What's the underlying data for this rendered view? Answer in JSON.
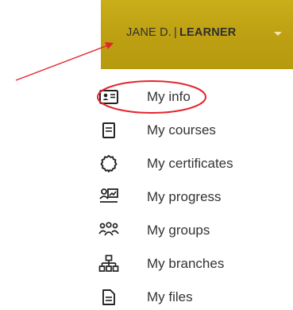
{
  "user_menu": {
    "name": "JANE D.",
    "separator": "|",
    "role": "LEARNER",
    "caret_icon": "chevron-down-icon"
  },
  "menu": {
    "items": [
      {
        "label": "My info",
        "icon": "id-card-icon"
      },
      {
        "label": "My courses",
        "icon": "book-icon"
      },
      {
        "label": "My certificates",
        "icon": "certificate-icon"
      },
      {
        "label": "My progress",
        "icon": "progress-icon"
      },
      {
        "label": "My groups",
        "icon": "groups-icon"
      },
      {
        "label": "My branches",
        "icon": "branches-icon"
      },
      {
        "label": "My files",
        "icon": "file-icon"
      }
    ]
  },
  "colors": {
    "bar": "#c2a416",
    "annotation": "#e3262e",
    "text": "#333333"
  }
}
